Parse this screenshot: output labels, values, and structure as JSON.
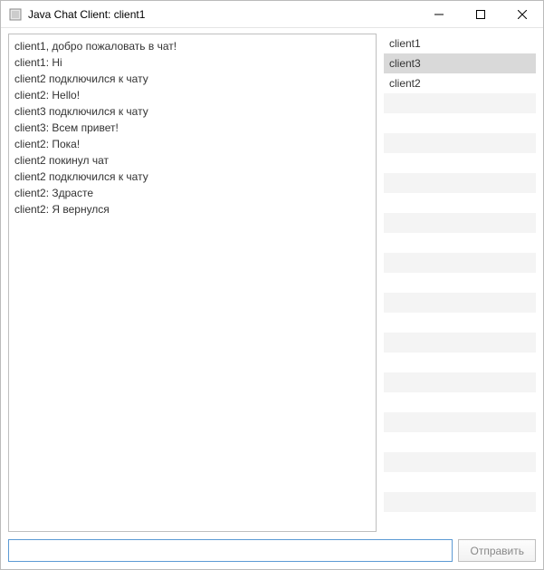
{
  "window": {
    "title": "Java Chat Client: client1"
  },
  "chat": {
    "messages": [
      "client1, добро пожаловать в чат!",
      "client1: Hi",
      "client2 подключился к чату",
      "client2: Hello!",
      "client3 подключился к чату",
      "client3: Всем привет!",
      "client2: Пока!",
      "client2 покинул чат",
      "client2 подключился к чату",
      "client2: Здрасте",
      "client2: Я вернулся"
    ]
  },
  "users": {
    "items": [
      "client1",
      "client3",
      "client2"
    ],
    "selected_index": 1
  },
  "input": {
    "value": "",
    "send_label": "Отправить"
  }
}
